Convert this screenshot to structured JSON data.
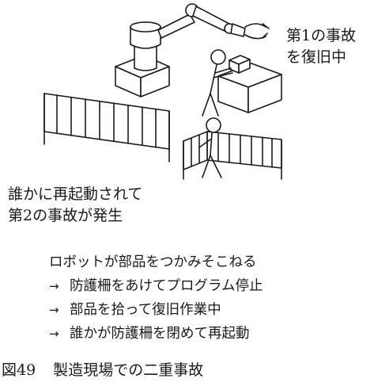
{
  "labels": {
    "first_accident": [
      "第1の事故",
      "を復旧中"
    ],
    "second_accident": [
      "誰かに再起動されて",
      "第2の事故が発生"
    ]
  },
  "steps": {
    "intro": "ロボットが部品をつかみそこねる",
    "items": [
      "防護柵をあけてプログラム停止",
      "部品を拾って復旧作業中",
      "誰かが防護柵を閉めて再起動"
    ],
    "arrow_glyph": "→"
  },
  "caption": {
    "number": "図49",
    "title": "製造現場での二重事故"
  }
}
